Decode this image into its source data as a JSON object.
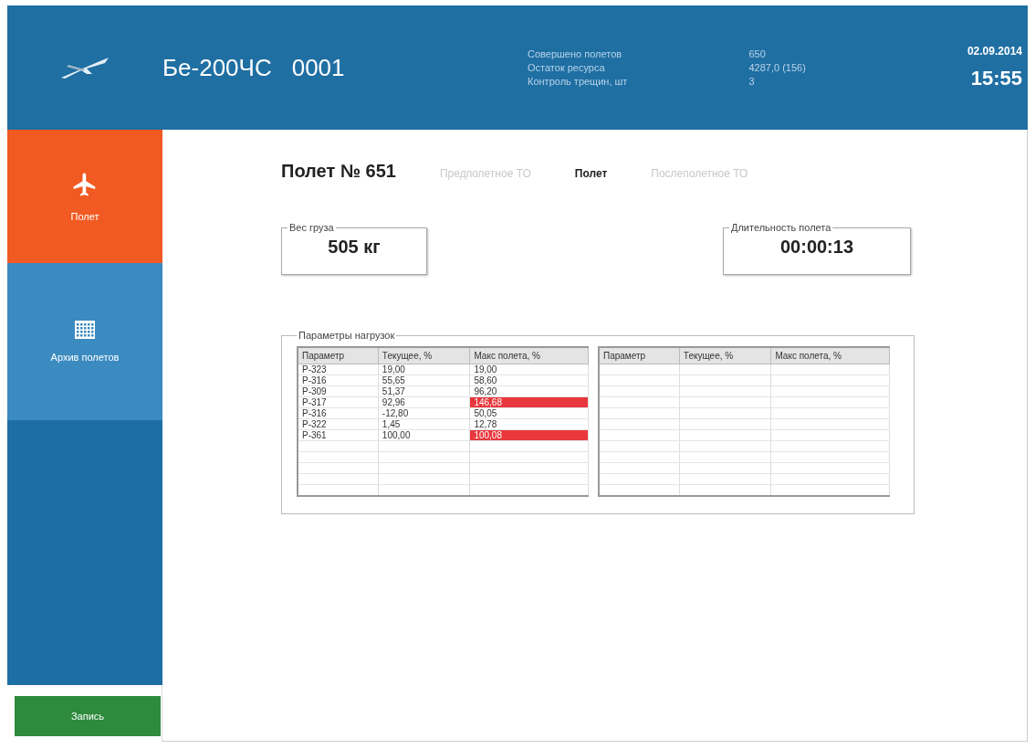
{
  "header": {
    "title": "Бе-200ЧС",
    "number": "0001",
    "stats": [
      {
        "label": "Совершено полетов",
        "value": "650"
      },
      {
        "label": "Остаток ресурса",
        "value": "4287,0 (156)"
      },
      {
        "label": "Контроль трещин, шт",
        "value": "3"
      }
    ],
    "date": "02.09.2014",
    "time": "15:55"
  },
  "sidebar": {
    "items": [
      {
        "kind": "plane",
        "label": "Полет",
        "selected": true
      },
      {
        "kind": "grid",
        "label": "Архив полетов",
        "selected": false
      }
    ],
    "record_button": "Запись"
  },
  "flight": {
    "title": "Полет № 651",
    "stages": [
      {
        "label": "Предполетное ТО",
        "selected": false
      },
      {
        "label": "Полет",
        "selected": true
      },
      {
        "label": "Послеполетное ТО",
        "selected": false
      }
    ]
  },
  "cargo": {
    "legend": "Вес груза",
    "value": "505 кг"
  },
  "duration": {
    "legend": "Длительность полета",
    "value": "00:00:13"
  },
  "loads": {
    "legend": "Параметры нагрузок",
    "tables": [
      {
        "columns": [
          "Параметр",
          "Текущее, %",
          "Макс полета, %"
        ],
        "rows": [
          {
            "param": "P-323",
            "current": "19,00",
            "max": "19,00",
            "alert": false
          },
          {
            "param": "P-316",
            "current": "55,65",
            "max": "58,60",
            "alert": false
          },
          {
            "param": "P-309",
            "current": "51,37",
            "max": "96,20",
            "alert": false
          },
          {
            "param": "P-317",
            "current": "92,96",
            "max": "146,68",
            "alert": true
          },
          {
            "param": "P-316",
            "current": "-12,80",
            "max": "50,05",
            "alert": false
          },
          {
            "param": "P-322",
            "current": "1,45",
            "max": "12,78",
            "alert": false
          },
          {
            "param": "P-361",
            "current": "100,00",
            "max": "100,08",
            "alert": true
          }
        ]
      },
      {
        "columns": [
          "Параметр",
          "Текущее, %",
          "Макс полета, %"
        ]
      }
    ]
  }
}
